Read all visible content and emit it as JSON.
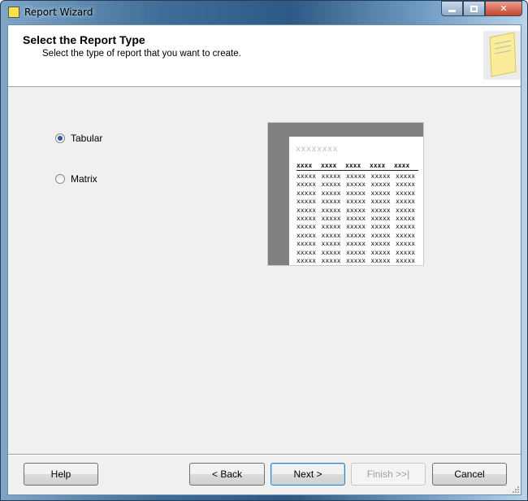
{
  "window": {
    "title": "Report Wizard",
    "icon": "report-wizard-icon"
  },
  "header": {
    "title": "Select the Report Type",
    "subtitle": "Select the type of report that you want to create."
  },
  "options": [
    {
      "label": "Tabular",
      "selected": true
    },
    {
      "label": "Matrix",
      "selected": false
    }
  ],
  "preview": {
    "title": "xxxxxxxx",
    "header": [
      "xxxx",
      "xxxx",
      "xxxx",
      "xxxx",
      "xxxx"
    ],
    "cell": "xxxxx",
    "row_count": 11,
    "column_count": 5
  },
  "buttons": {
    "help": "Help",
    "back": "< Back",
    "next": "Next >",
    "finish": "Finish >>|",
    "cancel": "Cancel"
  },
  "colors": {
    "accent": "#3c7fb1",
    "titlebar": "#2d5a84"
  }
}
